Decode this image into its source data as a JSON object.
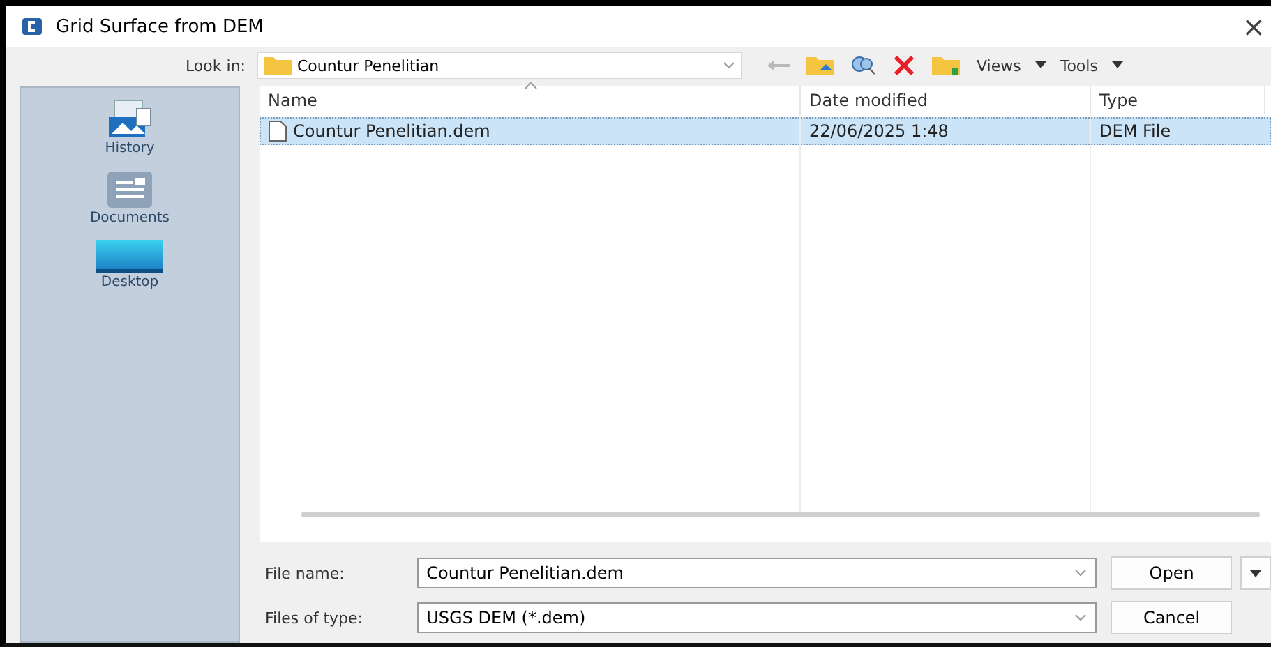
{
  "window": {
    "title": "Grid Surface from DEM",
    "close": "×"
  },
  "look_in": {
    "label": "Look in:",
    "value": "Countur Penelitian"
  },
  "toolbar": {
    "back_disabled": true,
    "views": "Views",
    "tools": "Tools"
  },
  "places": [
    {
      "label": "History",
      "kind": "history",
      "selected": false
    },
    {
      "label": "Documents",
      "kind": "documents",
      "selected": false
    },
    {
      "label": "Desktop",
      "kind": "desktop",
      "selected": false
    }
  ],
  "table": {
    "columns": [
      "Name",
      "Date modified",
      "Type"
    ],
    "rows": [
      {
        "cells": [
          "Countur Penelitian.dem",
          "22/06/2025 1:48",
          "DEM File"
        ],
        "selected": true
      }
    ]
  },
  "file_name": {
    "label": "File name:",
    "value": "Countur Penelitian.dem"
  },
  "file_type": {
    "label": "Files of type:",
    "value": "USGS DEM (*.dem)"
  },
  "buttons": [
    {
      "label": "Open",
      "kind": "split"
    },
    {
      "label": "Cancel",
      "kind": "plain"
    }
  ]
}
